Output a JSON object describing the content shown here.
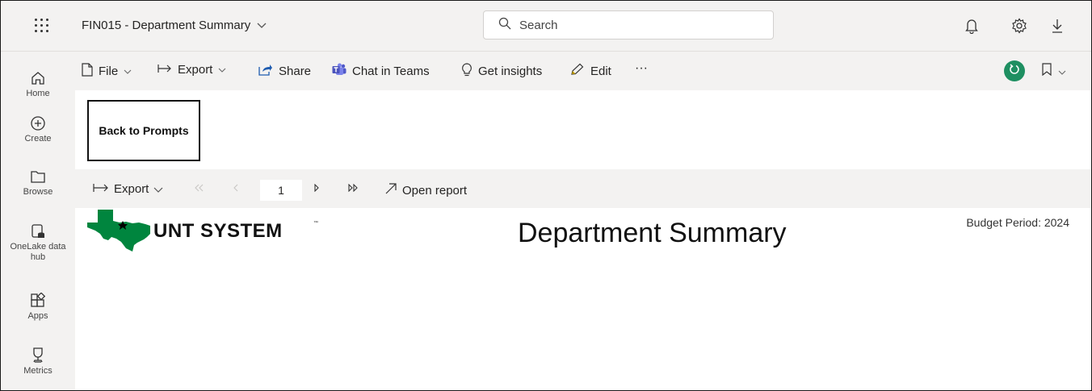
{
  "header": {
    "app_launcher_icon": "waffle-icon",
    "report_title": "FIN015 - Department Summary",
    "search_placeholder": "Search",
    "icons": [
      "bell-icon",
      "gear-icon",
      "download-icon"
    ]
  },
  "leftnav": {
    "items": [
      {
        "label": "Home",
        "icon": "home-icon"
      },
      {
        "label": "Create",
        "icon": "plus-circle-icon"
      },
      {
        "label": "Browse",
        "icon": "folder-icon"
      },
      {
        "label": "OneLake data hub",
        "icon": "database-icon"
      },
      {
        "label": "Apps",
        "icon": "apps-icon"
      },
      {
        "label": "Metrics",
        "icon": "trophy-icon"
      }
    ]
  },
  "commandbar": {
    "file_label": "File",
    "export_label": "Export",
    "share_label": "Share",
    "chat_label": "Chat in Teams",
    "insights_label": "Get insights",
    "edit_label": "Edit",
    "more_label": "···"
  },
  "report": {
    "back_button_label": "Back to Prompts",
    "toolbar": {
      "export_label": "Export",
      "page_number": "1",
      "open_report_label": "Open report"
    },
    "logo_text": "UNT SYSTEM",
    "logo_tm": "™",
    "title": "Department Summary",
    "budget_period": "Budget Period: 2024"
  },
  "colors": {
    "chrome_bg": "#f3f2f1",
    "accent_green": "#1e8f61",
    "logo_green": "#00853e"
  }
}
